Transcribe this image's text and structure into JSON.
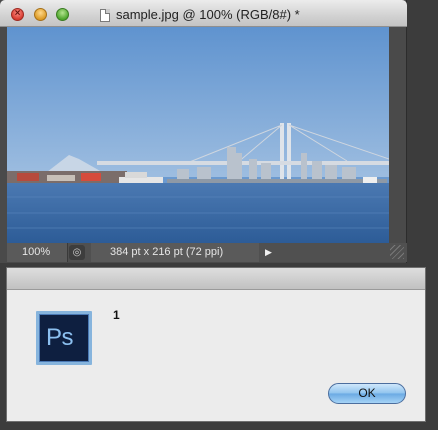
{
  "document_window": {
    "title": "sample.jpg @ 100% (RGB/8#) *",
    "controls": {
      "close_icon": "close-icon",
      "minimize_icon": "minimize-icon",
      "zoom_icon": "zoom-icon"
    },
    "canvas": {
      "description_icon": "photo-bay-bridge-skyline",
      "sky_color": "#6a9ad2",
      "water_color": "#3a6ba7"
    },
    "status_bar": {
      "zoom": "100%",
      "doc_info": "384 pt x 216 pt (72 ppi)",
      "play_icon": "▶",
      "menu_icon": "◎"
    }
  },
  "dialog": {
    "app_icon_text": "Ps",
    "message": "1",
    "ok_label": "OK",
    "accent": "#8ec3ee"
  }
}
